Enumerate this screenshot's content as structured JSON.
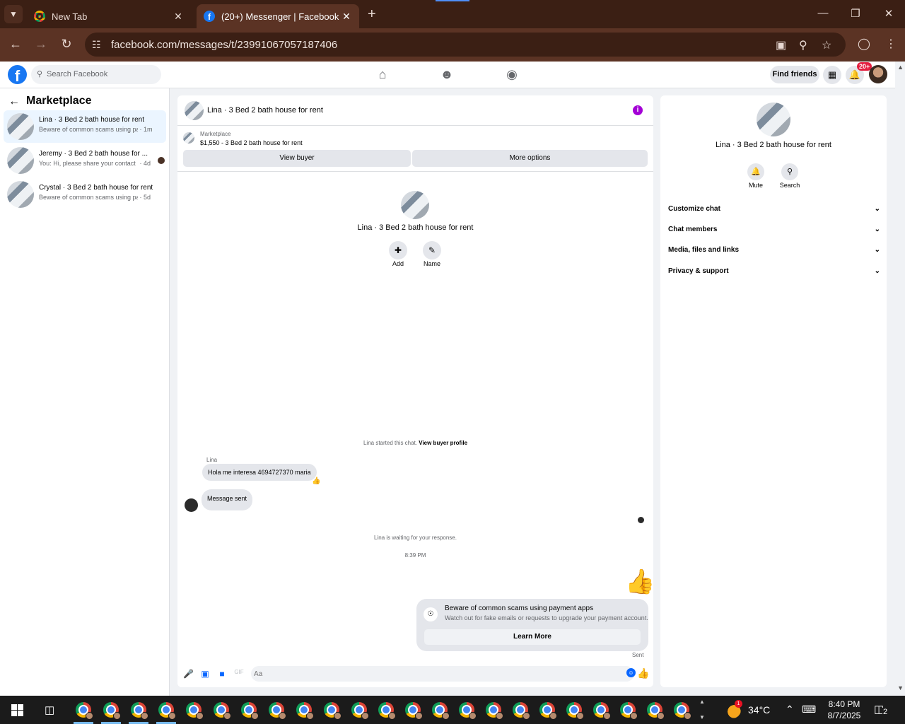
{
  "browser": {
    "tabs": [
      {
        "title": "New Tab",
        "active": false
      },
      {
        "title": "(20+) Messenger | Facebook",
        "active": true
      }
    ],
    "url": "facebook.com/messages/t/23991067057187406"
  },
  "fb_header": {
    "search_placeholder": "Search Facebook",
    "find_friends": "Find friends",
    "notification_badge": "20+"
  },
  "left_panel": {
    "title": "Marketplace",
    "conversations": [
      {
        "name": "Lina · 3 Bed 2 bath house for rent",
        "snippet": "Beware of common scams using pay...",
        "time": "· 1m",
        "selected": true
      },
      {
        "name": "Jeremy · 3 Bed 2 bath house for ...",
        "snippet": "You: Hi, please share your contact ...",
        "time": "· 4d",
        "selected": false
      },
      {
        "name": "Crystal · 3 Bed 2 bath house for rent",
        "snippet": "Beware of common scams using pay...",
        "time": "· 5d",
        "selected": false
      }
    ]
  },
  "chat": {
    "header_title": "Lina · 3 Bed 2 bath house for rent",
    "marketplace_label": "Marketplace",
    "listing": "$1,550 - 3 Bed 2 bath house for rent",
    "view_buyer": "View buyer",
    "more_options": "More options",
    "center_title": "Lina · 3 Bed 2 bath house for rent",
    "add_label": "Add",
    "name_label": "Name",
    "started_text": "Lina started this chat.",
    "view_buyer_profile": "View buyer profile",
    "sender_name": "Lina",
    "message_in": "Hola me interesa 4694727370 maria",
    "message_sent": "Message sent",
    "waiting_text": "Lina is waiting for your response.",
    "timestamp": "8:39 PM",
    "scam_title": "Beware of common scams using payment apps",
    "scam_body": "Watch out for fake emails or requests to upgrade your payment account.",
    "learn_more": "Learn More",
    "sent_status": "Sent",
    "composer_placeholder": "Aa"
  },
  "right_panel": {
    "title": "Lina · 3 Bed 2 bath house for rent",
    "mute": "Mute",
    "search": "Search",
    "sections": [
      "Customize chat",
      "Chat members",
      "Media, files and links",
      "Privacy & support"
    ]
  },
  "taskbar": {
    "temperature": "34°C",
    "time": "8:40 PM",
    "date": "8/7/2025",
    "weather_badge": "1",
    "notifications": "2"
  },
  "colors": {
    "fb_blue": "#1877f2",
    "messenger_blue": "#0866ff",
    "like_purple": "#5b4cf5",
    "info_purple": "#a400d6",
    "chrome_frame": "#3b1f14"
  }
}
